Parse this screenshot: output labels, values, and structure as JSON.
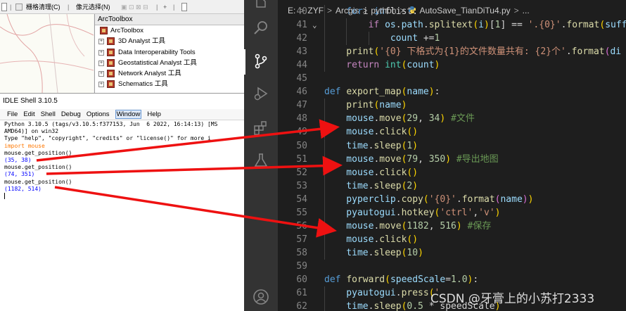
{
  "arcgis": {
    "toolbar": {
      "raster_cleanup": "栅格清理(C)",
      "pixel_select": "像元选择(N)"
    },
    "arctoolbox": {
      "panel_title": "ArcToolbox",
      "items": [
        {
          "label": "ArcToolbox",
          "expander": ""
        },
        {
          "label": "3D Analyst 工具",
          "expander": "+"
        },
        {
          "label": "Data Interoperability Tools",
          "expander": "+"
        },
        {
          "label": "Geostatistical Analyst 工具",
          "expander": "+"
        },
        {
          "label": "Network Analyst 工具",
          "expander": "+"
        },
        {
          "label": "Schematics 工具",
          "expander": "+"
        }
      ]
    }
  },
  "idle": {
    "title": "IDLE Shell 3.10.5",
    "menu": [
      "File",
      "Edit",
      "Shell",
      "Debug",
      "Options",
      "Window",
      "Help"
    ],
    "active_menu": "Window",
    "lines": [
      {
        "text": "Python 3.10.5 (tags/v3.10.5:f377153, Jun  6 2022, 16:14:13) [MS",
        "cls": ""
      },
      {
        "text": "AMD64)] on win32",
        "cls": ""
      },
      {
        "text": "Type \"help\", \"copyright\", \"credits\" or \"license()\" for more i",
        "cls": ""
      },
      {
        "text": "import mouse",
        "cls": "kw"
      },
      {
        "text": "mouse.get_position()",
        "cls": ""
      },
      {
        "text": "(35, 38)",
        "cls": "out"
      },
      {
        "text": "mouse.get_position()",
        "cls": ""
      },
      {
        "text": "(74, 351)",
        "cls": "out"
      },
      {
        "text": "mouse.get_position()",
        "cls": ""
      },
      {
        "text": "(1182, 514)",
        "cls": "out"
      }
    ]
  },
  "vscode": {
    "breadcrumb": [
      "E:",
      "ZYF",
      "Arcgis",
      "python",
      "AutoSave_TianDiTu4.py",
      "..."
    ],
    "code_lines": [
      {
        "num": "40",
        "fold": "",
        "indent": 1,
        "tokens": [
          [
            "k",
            "for"
          ],
          [
            "",
            "i "
          ],
          [
            "k",
            "in"
          ],
          [
            "",
            "flist:"
          ]
        ]
      },
      {
        "num": "41",
        "fold": "⌄",
        "indent": 2,
        "tokens": [
          [
            "kc",
            "if "
          ],
          [
            "v",
            "os"
          ],
          [
            "",
            "."
          ],
          [
            "v",
            "path"
          ],
          [
            "",
            "."
          ],
          [
            "f",
            "splitext"
          ],
          [
            "p",
            "("
          ],
          [
            "v",
            "i"
          ],
          [
            "p",
            ")"
          ],
          [
            "",
            "["
          ],
          [
            "n",
            "1"
          ],
          [
            "",
            "] == "
          ],
          [
            "s",
            "'.{0}'"
          ],
          [
            "",
            "."
          ],
          [
            "f",
            "format"
          ],
          [
            "p",
            "("
          ],
          [
            "v",
            "suffi"
          ]
        ]
      },
      {
        "num": "42",
        "fold": "",
        "indent": 3,
        "tokens": [
          [
            "v",
            "count"
          ],
          [
            "",
            " +="
          ],
          [
            "n",
            "1"
          ]
        ]
      },
      {
        "num": "43",
        "fold": "",
        "indent": 1,
        "tokens": [
          [
            "f",
            "print"
          ],
          [
            "p",
            "("
          ],
          [
            "s",
            "'{0} 下格式为{1}的文件数量共有: {2}个'"
          ],
          [
            "",
            "."
          ],
          [
            "f",
            "format"
          ],
          [
            "p2",
            "("
          ],
          [
            "v",
            "di"
          ]
        ]
      },
      {
        "num": "44",
        "fold": "",
        "indent": 1,
        "tokens": [
          [
            "kc",
            "return "
          ],
          [
            "t",
            "int"
          ],
          [
            "p",
            "("
          ],
          [
            "v",
            "count"
          ],
          [
            "p",
            ")"
          ]
        ]
      },
      {
        "num": "45",
        "fold": "",
        "indent": 0,
        "tokens": []
      },
      {
        "num": "46",
        "fold": "",
        "indent": 0,
        "tokens": [
          [
            "k",
            "def "
          ],
          [
            "f",
            "export_map"
          ],
          [
            "p",
            "("
          ],
          [
            "v",
            "name"
          ],
          [
            "p",
            ")"
          ],
          [
            "",
            ":"
          ]
        ]
      },
      {
        "num": "47",
        "fold": "",
        "indent": 1,
        "tokens": [
          [
            "f",
            "print"
          ],
          [
            "p",
            "("
          ],
          [
            "v",
            "name"
          ],
          [
            "p",
            ")"
          ]
        ]
      },
      {
        "num": "48",
        "fold": "",
        "indent": 1,
        "tokens": [
          [
            "v",
            "mouse"
          ],
          [
            "",
            "."
          ],
          [
            "f",
            "move"
          ],
          [
            "p",
            "("
          ],
          [
            "n",
            "29"
          ],
          [
            ", "
          ],
          [
            "n",
            "34"
          ],
          [
            "p",
            ")"
          ],
          [
            "",
            " "
          ],
          [
            "c",
            "#文件"
          ]
        ]
      },
      {
        "num": "49",
        "fold": "",
        "indent": 1,
        "tokens": [
          [
            "v",
            "mouse"
          ],
          [
            "",
            "."
          ],
          [
            "f",
            "click"
          ],
          [
            "p",
            "()"
          ]
        ]
      },
      {
        "num": "50",
        "fold": "",
        "indent": 1,
        "tokens": [
          [
            "v",
            "time"
          ],
          [
            "",
            "."
          ],
          [
            "f",
            "sleep"
          ],
          [
            "p",
            "("
          ],
          [
            "n",
            "1"
          ],
          [
            "p",
            ")"
          ]
        ]
      },
      {
        "num": "51",
        "fold": "",
        "indent": 1,
        "tokens": [
          [
            "v",
            "mouse"
          ],
          [
            "",
            "."
          ],
          [
            "f",
            "move"
          ],
          [
            "p",
            "("
          ],
          [
            "n",
            "79"
          ],
          [
            ", "
          ],
          [
            "n",
            "350"
          ],
          [
            "p",
            ")"
          ],
          [
            "",
            " "
          ],
          [
            "c",
            "#导出地图"
          ]
        ]
      },
      {
        "num": "52",
        "fold": "",
        "indent": 1,
        "tokens": [
          [
            "v",
            "mouse"
          ],
          [
            "",
            "."
          ],
          [
            "f",
            "click"
          ],
          [
            "p",
            "()"
          ]
        ]
      },
      {
        "num": "53",
        "fold": "",
        "indent": 1,
        "tokens": [
          [
            "v",
            "time"
          ],
          [
            "",
            "."
          ],
          [
            "f",
            "sleep"
          ],
          [
            "p",
            "("
          ],
          [
            "n",
            "2"
          ],
          [
            "p",
            ")"
          ]
        ]
      },
      {
        "num": "54",
        "fold": "",
        "indent": 1,
        "tokens": [
          [
            "v",
            "pyperclip"
          ],
          [
            "",
            "."
          ],
          [
            "f",
            "copy"
          ],
          [
            "p",
            "("
          ],
          [
            "s",
            "'{0}'"
          ],
          [
            "",
            "."
          ],
          [
            "f",
            "format"
          ],
          [
            "p2",
            "("
          ],
          [
            "v",
            "name"
          ],
          [
            "p2",
            ")"
          ],
          [
            "p",
            ")"
          ]
        ]
      },
      {
        "num": "55",
        "fold": "",
        "indent": 1,
        "tokens": [
          [
            "v",
            "pyautogui"
          ],
          [
            "",
            "."
          ],
          [
            "f",
            "hotkey"
          ],
          [
            "p",
            "("
          ],
          [
            "s",
            "'ctrl'"
          ],
          [
            "",
            ","
          ],
          [
            "s",
            "'v'"
          ],
          [
            "p",
            ")"
          ]
        ]
      },
      {
        "num": "56",
        "fold": "",
        "indent": 1,
        "tokens": [
          [
            "v",
            "mouse"
          ],
          [
            "",
            "."
          ],
          [
            "f",
            "move"
          ],
          [
            "p",
            "("
          ],
          [
            "n",
            "1182"
          ],
          [
            ", "
          ],
          [
            "n",
            "516"
          ],
          [
            "p",
            ")"
          ],
          [
            "",
            " "
          ],
          [
            "c",
            "#保存"
          ]
        ]
      },
      {
        "num": "57",
        "fold": "",
        "indent": 1,
        "tokens": [
          [
            "v",
            "mouse"
          ],
          [
            "",
            "."
          ],
          [
            "f",
            "click"
          ],
          [
            "p",
            "()"
          ]
        ]
      },
      {
        "num": "58",
        "fold": "",
        "indent": 1,
        "tokens": [
          [
            "v",
            "time"
          ],
          [
            "",
            "."
          ],
          [
            "f",
            "sleep"
          ],
          [
            "p",
            "("
          ],
          [
            "n",
            "10"
          ],
          [
            "p",
            ")"
          ]
        ]
      },
      {
        "num": "59",
        "fold": "",
        "indent": 0,
        "tokens": []
      },
      {
        "num": "60",
        "fold": "",
        "indent": 0,
        "tokens": [
          [
            "k",
            "def "
          ],
          [
            "f",
            "forward"
          ],
          [
            "p",
            "("
          ],
          [
            "v",
            "speedScale"
          ],
          [
            "",
            "="
          ],
          [
            "n",
            "1.0"
          ],
          [
            "p",
            ")"
          ],
          [
            "",
            ":"
          ]
        ]
      },
      {
        "num": "61",
        "fold": "",
        "indent": 1,
        "tokens": [
          [
            "v",
            "pyautogui"
          ],
          [
            "",
            "."
          ],
          [
            "f",
            "press"
          ],
          [
            "p",
            "("
          ],
          [
            "s",
            "'"
          ]
        ]
      },
      {
        "num": "62",
        "fold": "",
        "indent": 1,
        "tokens": [
          [
            "v",
            "time"
          ],
          [
            "",
            "."
          ],
          [
            "f",
            "sleep"
          ],
          [
            "p",
            "("
          ],
          [
            "n",
            "0.5"
          ],
          [
            "",
            " * speedScale"
          ],
          [
            "p",
            ")"
          ]
        ]
      }
    ],
    "watermark": "CSDN @牙膏上的小苏打2333"
  },
  "colors": {
    "annotation_arrow": "#ee1111",
    "vscode_bg": "#1e1e1e",
    "activity_bar": "#333333"
  }
}
